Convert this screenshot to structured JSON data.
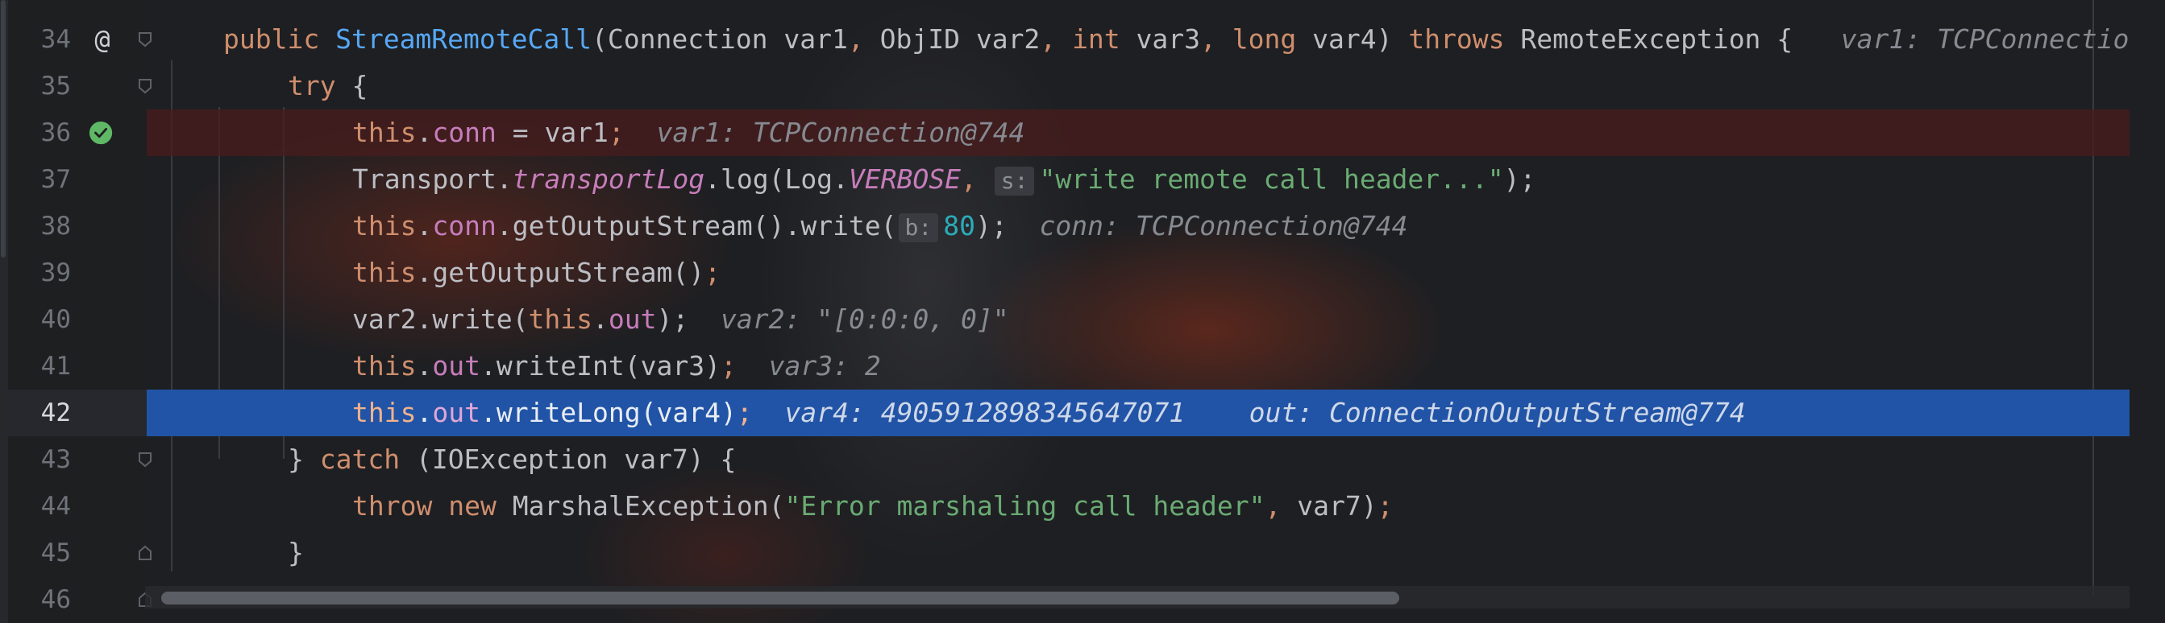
{
  "editor": {
    "theme_colors": {
      "background": "#1e1f22",
      "keyword": "#cf8e6d",
      "string": "#6aab73",
      "field": "#c77dbb",
      "method": "#56a8f5",
      "execution_line": "#2154a6",
      "breakpoint_line": "#4a1c1c"
    },
    "lines": [
      {
        "number": "34",
        "gutter_icon": "at-sign-implements-icon",
        "gutter_glyph": "@"
      },
      {
        "number": "35"
      },
      {
        "number": "36",
        "gutter_icon": "breakpoint-checked-icon"
      },
      {
        "number": "37"
      },
      {
        "number": "38"
      },
      {
        "number": "39"
      },
      {
        "number": "40"
      },
      {
        "number": "41"
      },
      {
        "number": "42",
        "current": true
      },
      {
        "number": "43"
      },
      {
        "number": "44"
      },
      {
        "number": "45"
      },
      {
        "number": "46"
      }
    ],
    "code": {
      "l34": {
        "kw_public": "public",
        "method": "StreamRemoteCall",
        "p1": "(Connection var1",
        "comma1": ", ",
        "p2": "ObjID var2",
        "comma2": ", ",
        "kw_int": "int",
        "p3": " var3",
        "comma3": ", ",
        "kw_long": "long",
        "p4": " var4) ",
        "kw_throws": "throws",
        "rest": " RemoteException {",
        "hint": "var1: TCPConnectio"
      },
      "l35": {
        "kw_try": "try",
        "rest": " {"
      },
      "l36": {
        "kw_this": "this",
        "dot": ".",
        "field": "conn",
        "rest": " = var1",
        "semi": ";",
        "hint": "var1: TCPConnection@744"
      },
      "l37": {
        "a": "Transport.",
        "static_field": "transportLog",
        "b": ".log(Log.",
        "static_const": "VERBOSE",
        "comma": ", ",
        "param_hint": "s:",
        "str": "\"write remote call header...\"",
        "end": ");"
      },
      "l38": {
        "kw_this": "this",
        "dot": ".",
        "field": "conn",
        "a": ".getOutputStream().write(",
        "param_hint": "b:",
        "num": "80",
        "end": ");",
        "hint": "conn: TCPConnection@744"
      },
      "l39": {
        "kw_this": "this",
        "a": ".getOutputStream()",
        "semi": ";"
      },
      "l40": {
        "a": "var2.write(",
        "kw_this": "this",
        "dot": ".",
        "field": "out",
        "end": ");",
        "hint": "var2: \"[0:0:0, 0]\""
      },
      "l41": {
        "kw_this": "this",
        "dot": ".",
        "field": "out",
        "a": ".writeInt(var3)",
        "semi": ";",
        "hint": "var3: 2"
      },
      "l42": {
        "kw_this": "this",
        "dot": ".",
        "field": "out",
        "a": ".writeLong(var4)",
        "semi": ";",
        "hint1": "var4: 4905912898345647071",
        "hint2": "out: ConnectionOutputStream@774"
      },
      "l43": {
        "a": "} ",
        "kw_catch": "catch",
        "b": " (IOException var7) {"
      },
      "l44": {
        "kw_throw": "throw",
        "sp": " ",
        "kw_new": "new",
        "a": " MarshalException(",
        "str": "\"Error marshaling call header\"",
        "comma": ", ",
        "b": "var7)",
        "semi": ";"
      },
      "l45": {
        "a": "}"
      }
    }
  }
}
